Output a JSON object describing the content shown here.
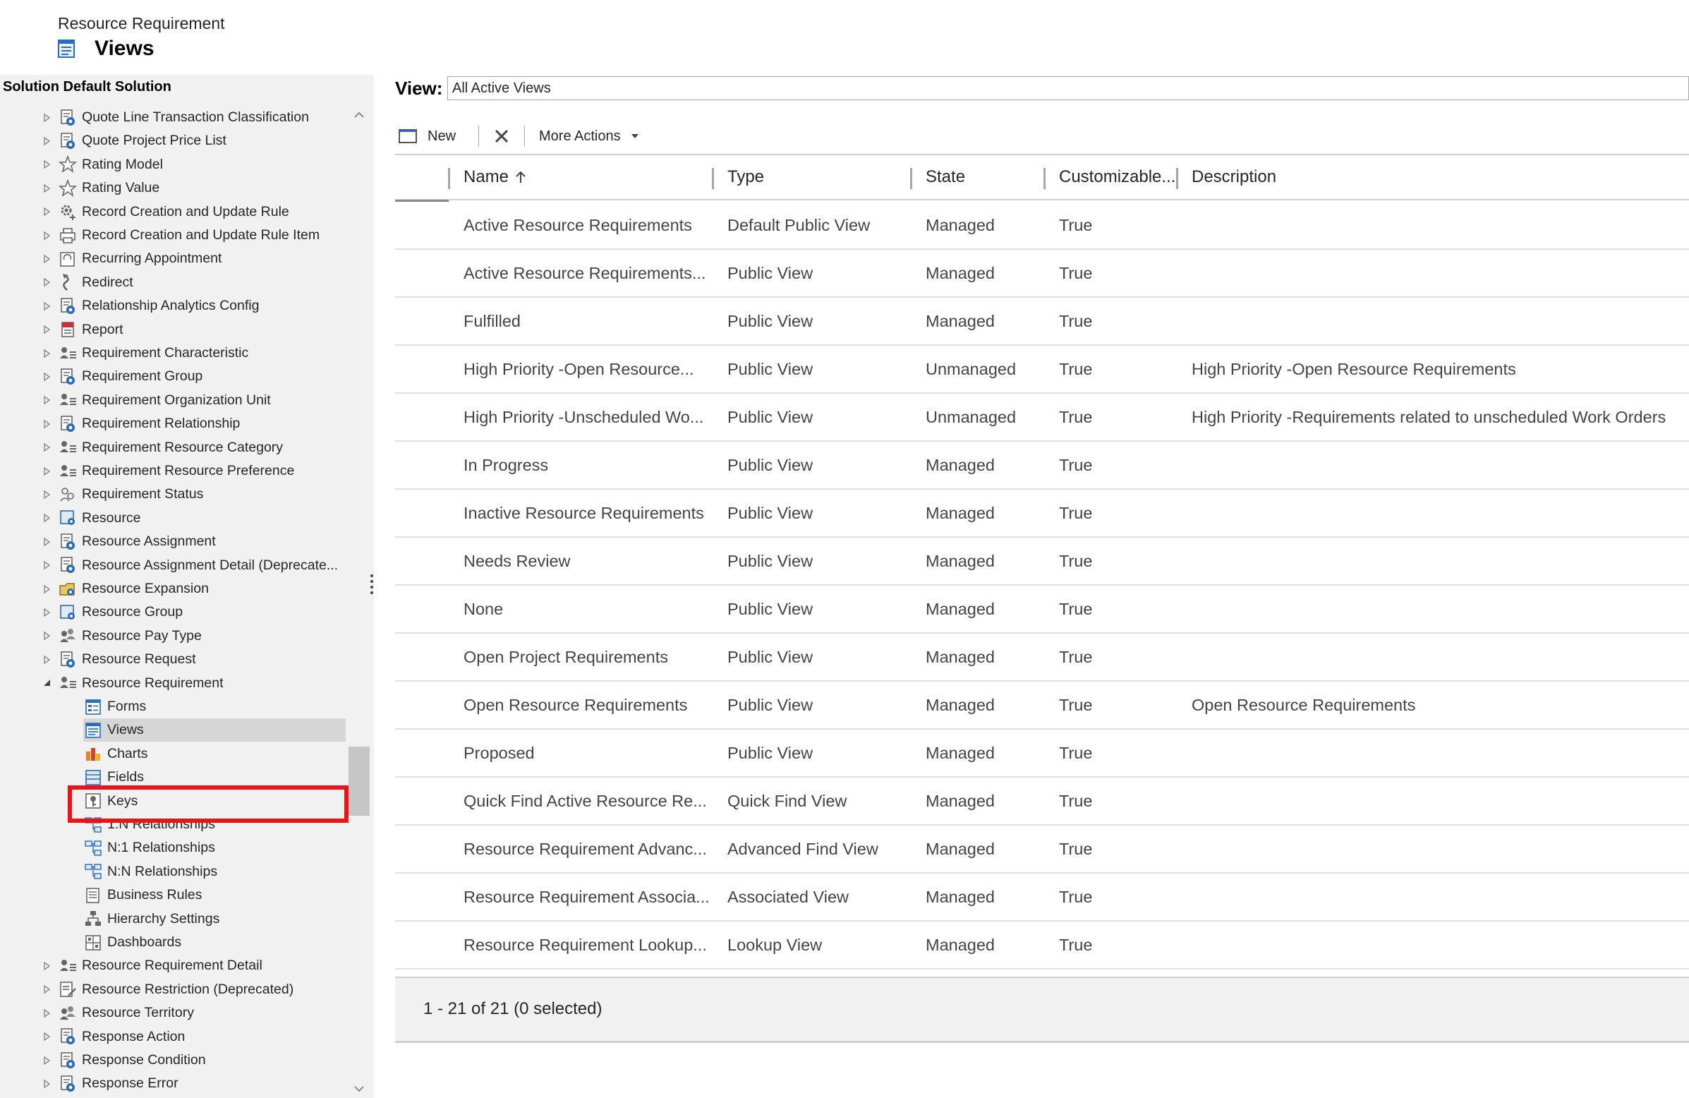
{
  "header": {
    "entity": "Resource Requirement",
    "title": "Views"
  },
  "sidebar": {
    "solution_label": "Solution Default Solution",
    "items": [
      {
        "label": "Quote Line Transaction Classification",
        "icon": "entity-gear-icon",
        "level": 1,
        "expanded": false
      },
      {
        "label": "Quote Project Price List",
        "icon": "entity-gear-icon",
        "level": 1,
        "expanded": false
      },
      {
        "label": "Rating Model",
        "icon": "star-icon",
        "level": 1,
        "expanded": false
      },
      {
        "label": "Rating Value",
        "icon": "star-icon",
        "level": 1,
        "expanded": false
      },
      {
        "label": "Record Creation and Update Rule",
        "icon": "gear-plus-icon",
        "level": 1,
        "expanded": false
      },
      {
        "label": "Record Creation and Update Rule Item",
        "icon": "printer-icon",
        "level": 1,
        "expanded": false
      },
      {
        "label": "Recurring Appointment",
        "icon": "recurring-calendar-icon",
        "level": 1,
        "expanded": false
      },
      {
        "label": "Redirect",
        "icon": "redirect-arrow-icon",
        "level": 1,
        "expanded": false
      },
      {
        "label": "Relationship Analytics Config",
        "icon": "entity-gear-icon",
        "level": 1,
        "expanded": false
      },
      {
        "label": "Report",
        "icon": "report-icon",
        "level": 1,
        "expanded": false
      },
      {
        "label": "Requirement Characteristic",
        "icon": "person-list-icon",
        "level": 1,
        "expanded": false
      },
      {
        "label": "Requirement Group",
        "icon": "entity-gear-icon",
        "level": 1,
        "expanded": false
      },
      {
        "label": "Requirement Organization Unit",
        "icon": "person-list-icon",
        "level": 1,
        "expanded": false
      },
      {
        "label": "Requirement Relationship",
        "icon": "entity-gear-icon",
        "level": 1,
        "expanded": false
      },
      {
        "label": "Requirement Resource Category",
        "icon": "person-list-icon",
        "level": 1,
        "expanded": false
      },
      {
        "label": "Requirement Resource Preference",
        "icon": "person-list-icon",
        "level": 1,
        "expanded": false
      },
      {
        "label": "Requirement Status",
        "icon": "status-people-icon",
        "level": 1,
        "expanded": false
      },
      {
        "label": "Resource",
        "icon": "resource-icon",
        "level": 1,
        "expanded": false
      },
      {
        "label": "Resource Assignment",
        "icon": "entity-gear-icon",
        "level": 1,
        "expanded": false
      },
      {
        "label": "Resource Assignment Detail (Deprecate...",
        "icon": "entity-gear-icon",
        "level": 1,
        "expanded": false
      },
      {
        "label": "Resource Expansion",
        "icon": "folder-gear-icon",
        "level": 1,
        "expanded": false
      },
      {
        "label": "Resource Group",
        "icon": "resource-icon",
        "level": 1,
        "expanded": false
      },
      {
        "label": "Resource Pay Type",
        "icon": "people-icon",
        "level": 1,
        "expanded": false
      },
      {
        "label": "Resource Request",
        "icon": "entity-gear-icon",
        "level": 1,
        "expanded": false
      },
      {
        "label": "Resource Requirement",
        "icon": "person-list-icon",
        "level": 1,
        "expanded": true
      },
      {
        "label": "Forms",
        "icon": "form-icon",
        "level": 2
      },
      {
        "label": "Views",
        "icon": "view-icon",
        "level": 2,
        "selected": true
      },
      {
        "label": "Charts",
        "icon": "chart-icon",
        "level": 2
      },
      {
        "label": "Fields",
        "icon": "fields-icon",
        "level": 2
      },
      {
        "label": "Keys",
        "icon": "key-icon",
        "level": 2
      },
      {
        "label": "1:N Relationships",
        "icon": "relationship-1n-icon",
        "level": 2
      },
      {
        "label": "N:1 Relationships",
        "icon": "relationship-n1-icon",
        "level": 2
      },
      {
        "label": "N:N Relationships",
        "icon": "relationship-nn-icon",
        "level": 2
      },
      {
        "label": "Business Rules",
        "icon": "business-rules-icon",
        "level": 2
      },
      {
        "label": "Hierarchy Settings",
        "icon": "hierarchy-icon",
        "level": 2
      },
      {
        "label": "Dashboards",
        "icon": "dashboard-icon",
        "level": 2
      },
      {
        "label": "Resource Requirement Detail",
        "icon": "person-list-icon",
        "level": 1,
        "expanded": false
      },
      {
        "label": "Resource Restriction (Deprecated)",
        "icon": "document-pen-icon",
        "level": 1,
        "expanded": false
      },
      {
        "label": "Resource Territory",
        "icon": "people-icon",
        "level": 1,
        "expanded": false
      },
      {
        "label": "Response Action",
        "icon": "entity-gear-icon",
        "level": 1,
        "expanded": false
      },
      {
        "label": "Response Condition",
        "icon": "entity-gear-icon",
        "level": 1,
        "expanded": false
      },
      {
        "label": "Response Error",
        "icon": "entity-gear-icon",
        "level": 1,
        "expanded": false
      }
    ]
  },
  "view": {
    "label": "View:",
    "selected": "All Active Views"
  },
  "toolbar": {
    "new_label": "New",
    "delete_icon": "delete-x-icon",
    "more_actions_label": "More Actions"
  },
  "grid": {
    "columns": [
      "Name",
      "Type",
      "State",
      "Customizable...",
      "Description"
    ],
    "sort_column": "Name",
    "sort_direction": "ascending",
    "rows": [
      {
        "name": "Active Resource Requirements",
        "type": "Default Public View",
        "state": "Managed",
        "customizable": "True",
        "description": ""
      },
      {
        "name": "Active Resource Requirements...",
        "type": "Public View",
        "state": "Managed",
        "customizable": "True",
        "description": ""
      },
      {
        "name": "Fulfilled",
        "type": "Public View",
        "state": "Managed",
        "customizable": "True",
        "description": ""
      },
      {
        "name": "High Priority -Open Resource...",
        "type": "Public View",
        "state": "Unmanaged",
        "customizable": "True",
        "description": "High Priority -Open Resource Requirements"
      },
      {
        "name": "High Priority -Unscheduled Wo...",
        "type": "Public View",
        "state": "Unmanaged",
        "customizable": "True",
        "description": "High Priority -Requirements related to unscheduled Work Orders"
      },
      {
        "name": "In Progress",
        "type": "Public View",
        "state": "Managed",
        "customizable": "True",
        "description": ""
      },
      {
        "name": "Inactive Resource Requirements",
        "type": "Public View",
        "state": "Managed",
        "customizable": "True",
        "description": ""
      },
      {
        "name": "Needs Review",
        "type": "Public View",
        "state": "Managed",
        "customizable": "True",
        "description": ""
      },
      {
        "name": "None",
        "type": "Public View",
        "state": "Managed",
        "customizable": "True",
        "description": ""
      },
      {
        "name": "Open Project Requirements",
        "type": "Public View",
        "state": "Managed",
        "customizable": "True",
        "description": ""
      },
      {
        "name": "Open Resource Requirements",
        "type": "Public View",
        "state": "Managed",
        "customizable": "True",
        "description": "Open Resource Requirements"
      },
      {
        "name": "Proposed",
        "type": "Public View",
        "state": "Managed",
        "customizable": "True",
        "description": ""
      },
      {
        "name": "Quick Find Active Resource Re...",
        "type": "Quick Find View",
        "state": "Managed",
        "customizable": "True",
        "description": ""
      },
      {
        "name": "Resource Requirement Advanc...",
        "type": "Advanced Find View",
        "state": "Managed",
        "customizable": "True",
        "description": ""
      },
      {
        "name": "Resource Requirement Associa...",
        "type": "Associated View",
        "state": "Managed",
        "customizable": "True",
        "description": ""
      },
      {
        "name": "Resource Requirement Lookup...",
        "type": "Lookup View",
        "state": "Managed",
        "customizable": "True",
        "description": ""
      }
    ],
    "footer": "1 - 21 of 21 (0 selected)"
  },
  "colors": {
    "highlight": "#e8141a",
    "sidebar_bg": "#f1f1f1",
    "selected_bg": "#d6d6d6",
    "icon_blue": "#2b6cb8"
  }
}
